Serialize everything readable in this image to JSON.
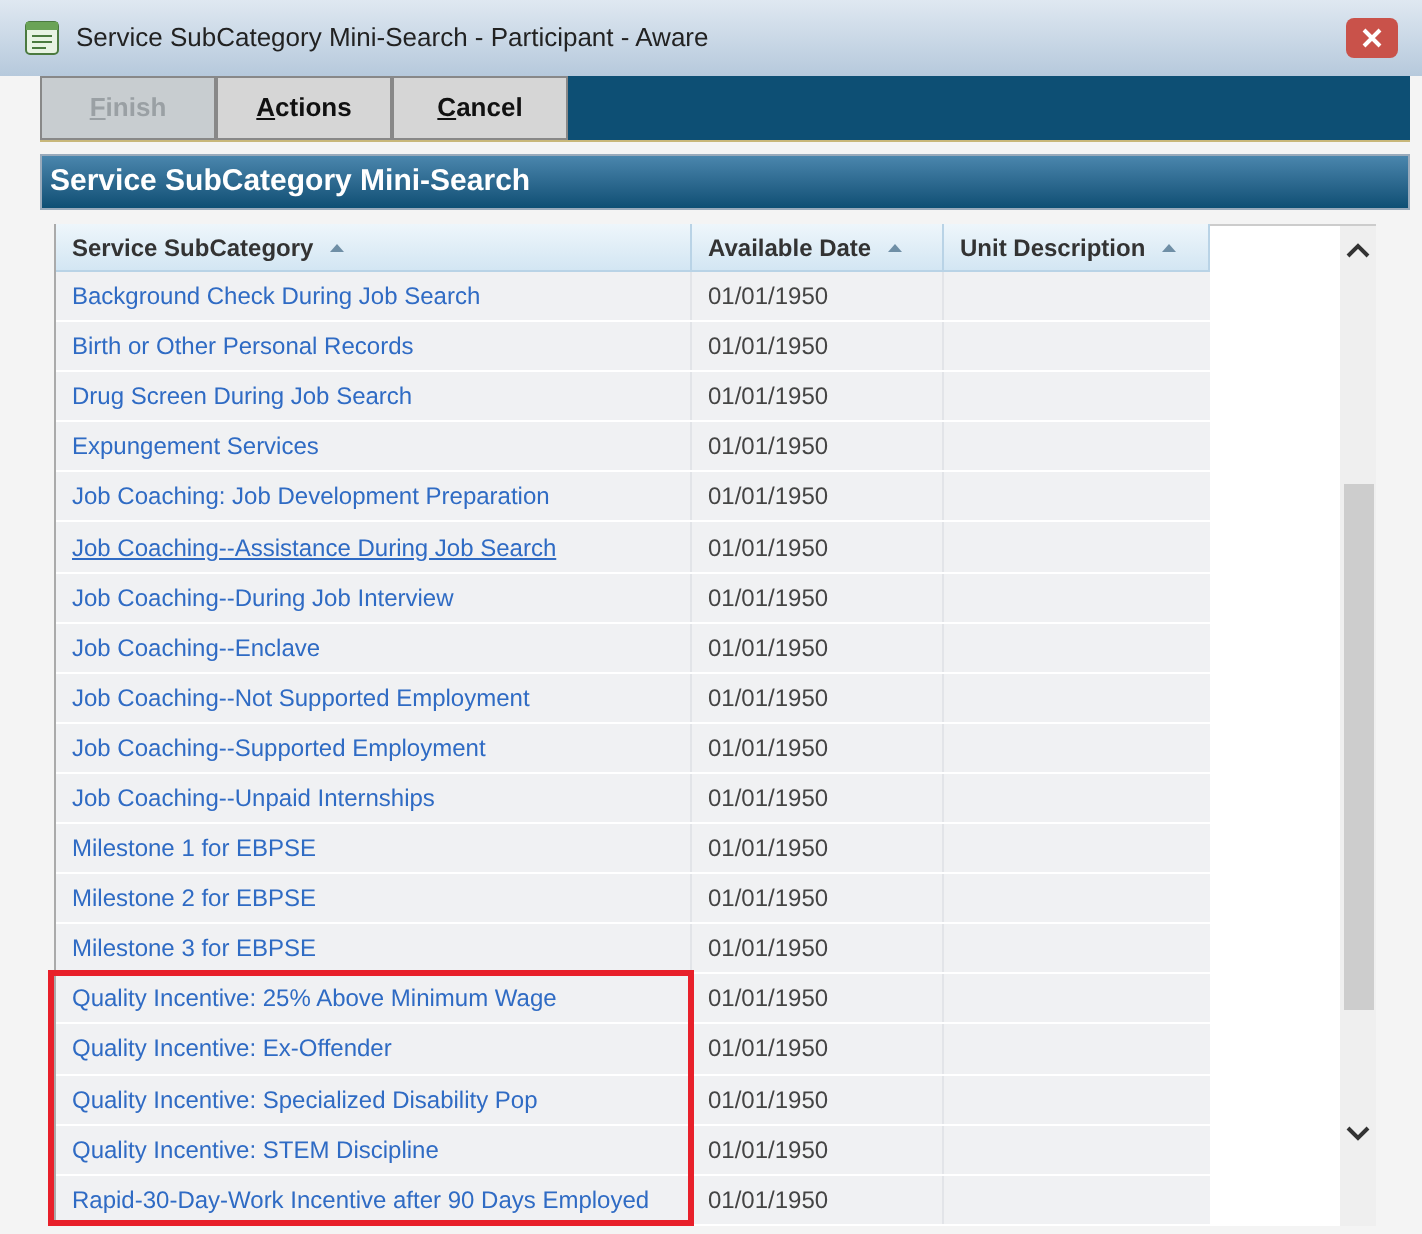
{
  "window": {
    "title": "Service SubCategory Mini-Search - Participant - Aware"
  },
  "toolbar": {
    "buttons": [
      {
        "mnemonic": "F",
        "rest": "inish",
        "disabled": true
      },
      {
        "mnemonic": "A",
        "rest": "ctions",
        "disabled": false
      },
      {
        "mnemonic": "C",
        "rest": "ancel",
        "disabled": false
      }
    ]
  },
  "panel": {
    "title": "Service SubCategory Mini-Search"
  },
  "table": {
    "columns": [
      {
        "label": "Service SubCategory",
        "sorted": true
      },
      {
        "label": "Available Date",
        "sorted": true
      },
      {
        "label": "Unit Description",
        "sorted": true
      }
    ],
    "rows": [
      {
        "name": "Background Check During Job Search",
        "date": "01/01/1950",
        "hovered": false,
        "highlighted": false
      },
      {
        "name": "Birth or Other Personal Records",
        "date": "01/01/1950",
        "hovered": false,
        "highlighted": false
      },
      {
        "name": "Drug Screen During Job Search",
        "date": "01/01/1950",
        "hovered": false,
        "highlighted": false
      },
      {
        "name": "Expungement Services",
        "date": "01/01/1950",
        "hovered": false,
        "highlighted": false
      },
      {
        "name": "Job Coaching: Job Development Preparation",
        "date": "01/01/1950",
        "hovered": false,
        "highlighted": false
      },
      {
        "name": "Job Coaching--Assistance During Job Search",
        "date": "01/01/1950",
        "hovered": true,
        "highlighted": false
      },
      {
        "name": "Job Coaching--During Job Interview",
        "date": "01/01/1950",
        "hovered": false,
        "highlighted": false
      },
      {
        "name": "Job Coaching--Enclave",
        "date": "01/01/1950",
        "hovered": false,
        "highlighted": false
      },
      {
        "name": "Job Coaching--Not Supported Employment",
        "date": "01/01/1950",
        "hovered": false,
        "highlighted": false
      },
      {
        "name": "Job Coaching--Supported Employment",
        "date": "01/01/1950",
        "hovered": false,
        "highlighted": false
      },
      {
        "name": "Job Coaching--Unpaid Internships",
        "date": "01/01/1950",
        "hovered": false,
        "highlighted": false
      },
      {
        "name": "Milestone 1 for EBPSE",
        "date": "01/01/1950",
        "hovered": false,
        "highlighted": false
      },
      {
        "name": "Milestone 2 for EBPSE",
        "date": "01/01/1950",
        "hovered": false,
        "highlighted": false
      },
      {
        "name": "Milestone 3 for EBPSE",
        "date": "01/01/1950",
        "hovered": false,
        "highlighted": false
      },
      {
        "name": "Quality Incentive: 25% Above Minimum Wage",
        "date": "01/01/1950",
        "hovered": false,
        "highlighted": true
      },
      {
        "name": "Quality Incentive: Ex-Offender",
        "date": "01/01/1950",
        "hovered": false,
        "highlighted": true
      },
      {
        "name": "Quality Incentive: Specialized Disability Pop",
        "date": "01/01/1950",
        "hovered": false,
        "highlighted": true
      },
      {
        "name": "Quality Incentive: STEM Discipline",
        "date": "01/01/1950",
        "hovered": false,
        "highlighted": true
      },
      {
        "name": "Rapid-30-Day-Work Incentive after 90 Days Employed",
        "date": "01/01/1950",
        "hovered": false,
        "highlighted": true
      }
    ]
  }
}
